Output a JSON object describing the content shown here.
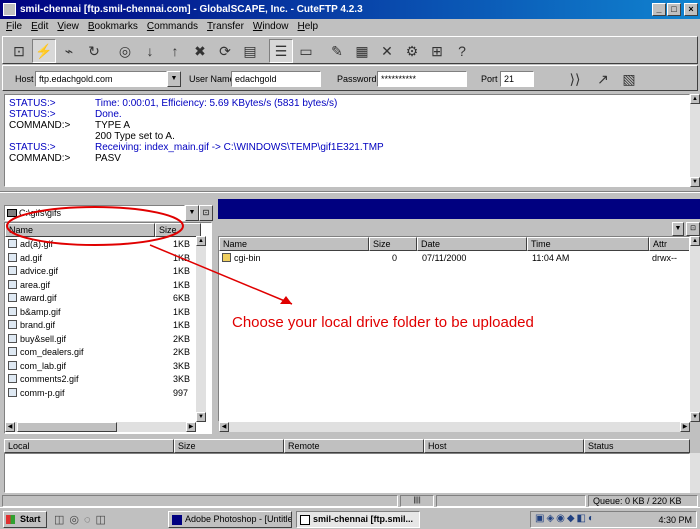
{
  "window": {
    "title": "smil-chennai [ftp.smil-chennai.com] - GlobalSCAPE, Inc. - CuteFTP 4.2.3",
    "controls": [
      "_",
      "□",
      "×"
    ]
  },
  "menu": [
    "File",
    "Edit",
    "View",
    "Bookmarks",
    "Commands",
    "Transfer",
    "Window",
    "Help"
  ],
  "toolbar": {
    "icons": [
      "connect-icon",
      "quick-connect-icon",
      "disconnect-icon",
      "reconnect-icon",
      "view-icon",
      "download-icon",
      "upload-icon",
      "stop-icon",
      "refresh-icon",
      "folder-icon",
      "list-view-icon",
      "details-view-icon",
      "edit-icon",
      "rename-icon",
      "delete-icon",
      "properties-icon",
      "mkdir-icon",
      "help-icon"
    ]
  },
  "connect": {
    "host_label": "Host",
    "host_value": "ftp.edachgold.com",
    "user_label": "User Name",
    "user_value": "edachgold",
    "password_label": "Password",
    "password_value": "**********",
    "port_label": "Port",
    "port_value": "21"
  },
  "log": [
    {
      "type": "status",
      "key": "STATUS:>",
      "text": "Time: 0:00:01, Efficiency: 5.69 KBytes/s (5831 bytes/s)"
    },
    {
      "type": "status",
      "key": "STATUS:>",
      "text": "Done."
    },
    {
      "type": "command",
      "key": "COMMAND:>",
      "text": "TYPE A"
    },
    {
      "type": "command",
      "key": "",
      "text": "200 Type set to A."
    },
    {
      "type": "status",
      "key": "STATUS:>",
      "text": "Receiving: index_main.gif -> C:\\WINDOWS\\TEMP\\gif1E321.TMP"
    },
    {
      "type": "command",
      "key": "COMMAND:>",
      "text": "PASV"
    }
  ],
  "local": {
    "path": "C:\\gifs\\gifs",
    "columns": [
      "Name",
      "Size"
    ],
    "files": [
      {
        "name": "ad(a).gif",
        "size": "1KB"
      },
      {
        "name": "ad.gif",
        "size": "1KB"
      },
      {
        "name": "advice.gif",
        "size": "1KB"
      },
      {
        "name": "area.gif",
        "size": "1KB"
      },
      {
        "name": "award.gif",
        "size": "6KB"
      },
      {
        "name": "b&amp.gif",
        "size": "1KB"
      },
      {
        "name": "brand.gif",
        "size": "1KB"
      },
      {
        "name": "buy&sell.gif",
        "size": "2KB"
      },
      {
        "name": "com_dealers.gif",
        "size": "2KB"
      },
      {
        "name": "com_lab.gif",
        "size": "3KB"
      },
      {
        "name": "comments2.gif",
        "size": "3KB"
      },
      {
        "name": "comm-p.gif",
        "size": "997"
      }
    ]
  },
  "remote": {
    "columns": [
      "Name",
      "Size",
      "Date",
      "Time",
      "Attr"
    ],
    "files": [
      {
        "name": "cgi-bin",
        "size": "0",
        "date": "07/11/2000",
        "time": "11:04 AM",
        "attr": "drwx--"
      }
    ]
  },
  "queue": {
    "columns": [
      "Local",
      "Size",
      "Remote",
      "Host",
      "Status"
    ]
  },
  "statusbar": {
    "queue": "Queue: 0 KB / 220 KB"
  },
  "taskbar": {
    "start": "Start",
    "buttons": [
      "Adobe Photoshop - [Untitled]",
      "smil-chennai [ftp.smil..."
    ],
    "clock": "4:30 PM"
  },
  "annotation": {
    "text": "Choose your local drive folder to be uploaded",
    "color": "#e00000"
  }
}
